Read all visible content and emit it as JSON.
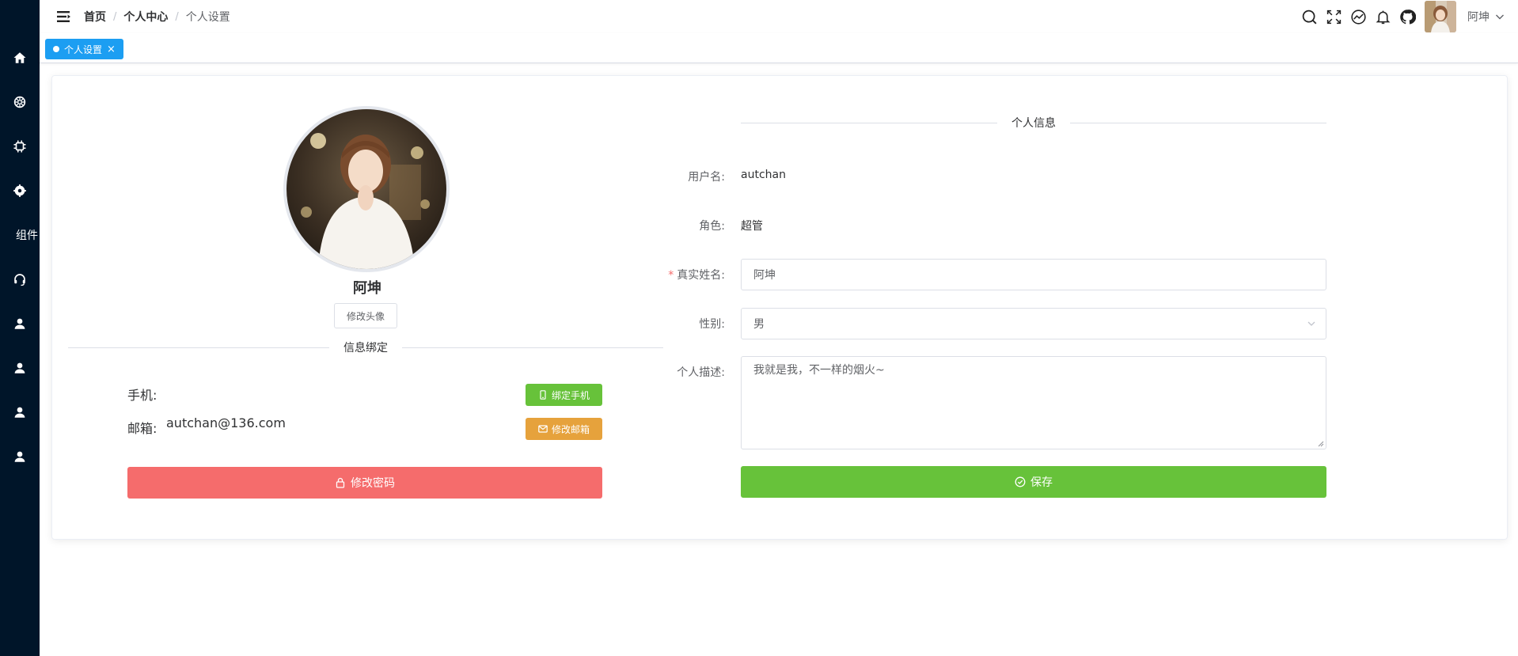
{
  "sidebar": {
    "items": [
      {
        "icon": "home-icon"
      },
      {
        "icon": "dashboard-icon"
      },
      {
        "icon": "chip-icon"
      },
      {
        "icon": "settings-icon"
      },
      {
        "label": "组件"
      },
      {
        "icon": "headset-icon"
      },
      {
        "icon": "user-icon"
      },
      {
        "icon": "user-icon"
      },
      {
        "icon": "user-icon"
      },
      {
        "icon": "user-icon"
      }
    ]
  },
  "header": {
    "breadcrumb": [
      "首页",
      "个人中心",
      "个人设置"
    ],
    "separator": "/",
    "icons": [
      "search-icon",
      "fullscreen-icon",
      "chart-icon",
      "bell-icon",
      "github-icon"
    ],
    "user_name": "阿坤"
  },
  "tags": {
    "active": {
      "label": "个人设置",
      "close": "×"
    }
  },
  "profile": {
    "nickname": "阿坤",
    "change_avatar": "修改头像",
    "binding_title": "信息绑定",
    "phone_label": "手机:",
    "phone_value": "",
    "email_label": "邮箱:",
    "email_value": "autchan@136.com",
    "bind_phone": "绑定手机",
    "change_email": "修改邮箱",
    "change_password": "修改密码"
  },
  "info": {
    "title": "个人信息",
    "username_label": "用户名:",
    "username": "autchan",
    "role_label": "角色:",
    "role": "超管",
    "realname_label": "真实姓名:",
    "realname_required": "*",
    "realname": "阿坤",
    "gender_label": "性别:",
    "gender": "男",
    "desc_label": "个人描述:",
    "desc": "我就是我，不一样的烟火~",
    "save": "保存"
  },
  "colors": {
    "sidebar_bg": "#001529",
    "tag_active": "#1c9ef2",
    "success": "#67c23a",
    "warning": "#e6a23c",
    "danger": "#f56c6c"
  }
}
